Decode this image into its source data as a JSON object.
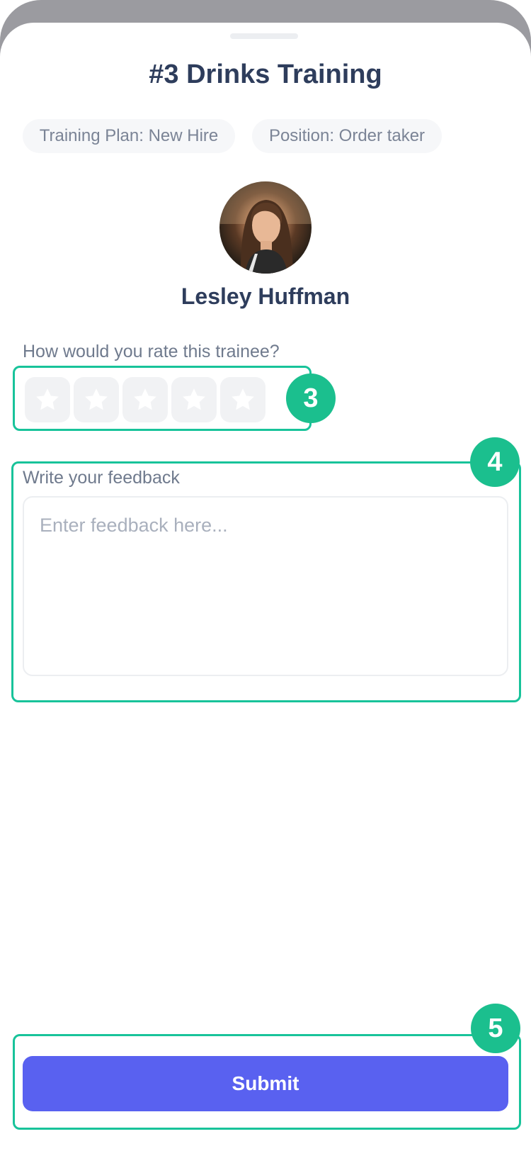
{
  "header": {
    "title": "#3 Drinks Training",
    "chips": {
      "training_plan": "Training Plan: New Hire",
      "position": "Position: Order taker"
    }
  },
  "trainee": {
    "name": "Lesley Huffman"
  },
  "rating": {
    "question": "How would you rate this trainee?",
    "max_stars": 5,
    "selected_stars": 0
  },
  "feedback": {
    "label": "Write your feedback",
    "placeholder": "Enter feedback here...",
    "value": ""
  },
  "actions": {
    "submit_label": "Submit"
  },
  "callouts": {
    "rating": "3",
    "feedback": "4",
    "submit": "5"
  },
  "colors": {
    "accent": "#5961f0",
    "callout": "#1bbf8e",
    "highlight_border": "#18c39a",
    "title_text": "#2e3d5c"
  }
}
